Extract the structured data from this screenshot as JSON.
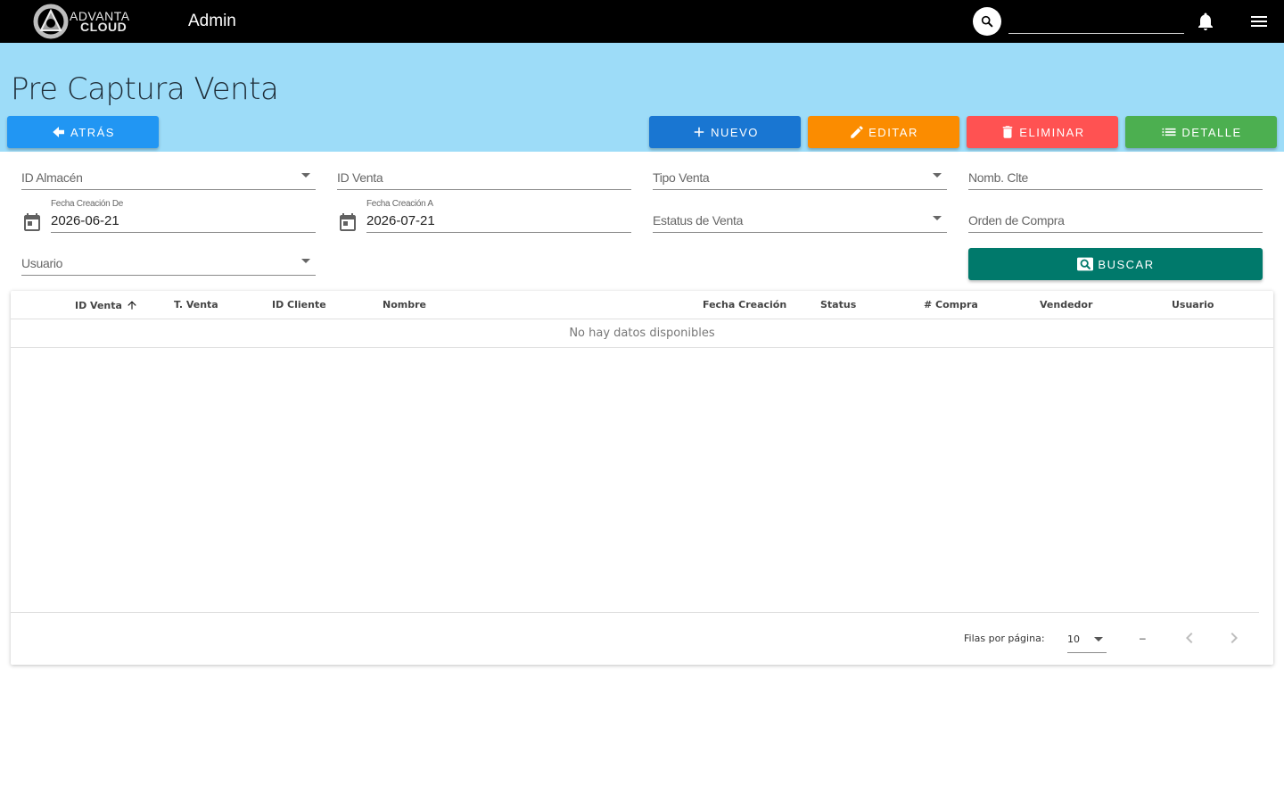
{
  "appbar": {
    "logo_line1": "ADVANTA",
    "logo_line2": "CLOUD",
    "title": "Admin",
    "search_value": ""
  },
  "page": {
    "title": "Pre Captura Venta"
  },
  "actions": {
    "back": "ATRÁS",
    "new": "NUEVO",
    "edit": "EDITAR",
    "delete": "ELIMINAR",
    "detail": "DETALLE",
    "search": "BUSCAR"
  },
  "filters": {
    "almacen": "ID Almacén",
    "id_venta": "ID Venta",
    "tipo_venta": "Tipo Venta",
    "nomb_clte": "Nomb. Clte",
    "fecha_de_label": "Fecha Creación De",
    "fecha_de_value": "2026-06-21",
    "fecha_a_label": "Fecha Creación A",
    "fecha_a_value": "2026-07-21",
    "estatus_venta": "Estatus de Venta",
    "orden_compra": "Orden de Compra",
    "usuario": "Usuario"
  },
  "table": {
    "columns": [
      "ID Venta",
      "T. Venta",
      "ID Cliente",
      "Nombre",
      "Fecha Creación",
      "Status",
      "# Compra",
      "Vendedor",
      "Usuario"
    ],
    "sorted_column": "ID Venta",
    "sort_direction": "asc",
    "empty_message": "No hay datos disponibles",
    "rows": [],
    "footer": {
      "rows_per_page_label": "Filas por página:",
      "rows_per_page_value": "10",
      "range": "–"
    }
  },
  "colors": {
    "appbar": "#000000",
    "header_band": "#9ddcf8",
    "back": "#2196f3",
    "new": "#1976d2",
    "edit": "#fb8c00",
    "delete": "#ff5252",
    "detail": "#4caf50",
    "search": "#00796b"
  }
}
